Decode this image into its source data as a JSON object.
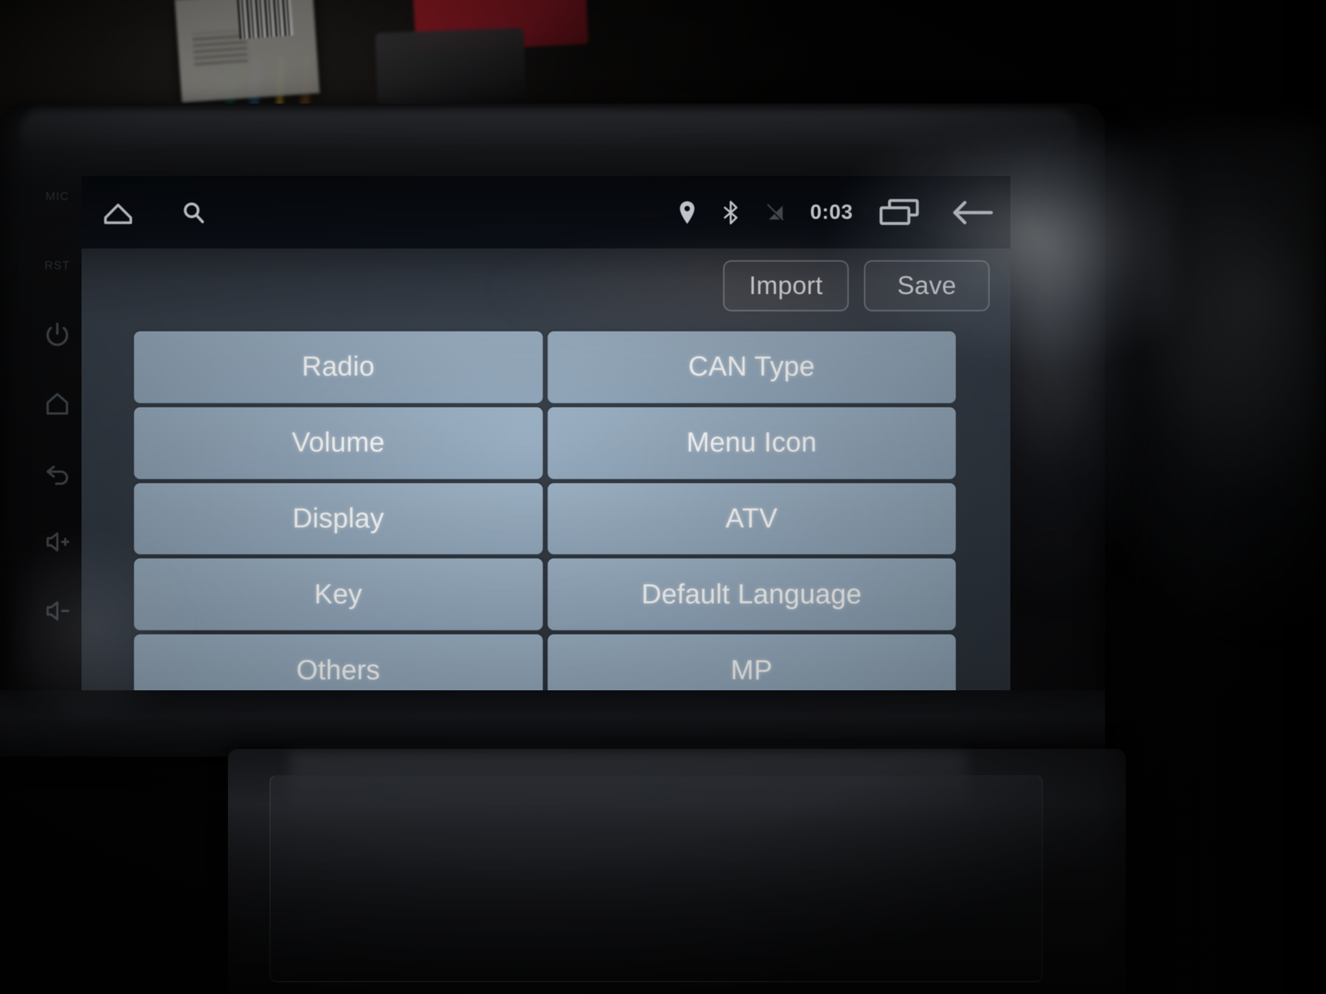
{
  "device": {
    "type": "car-head-unit",
    "hardware_keys": [
      {
        "name": "mic",
        "label": "MIC",
        "icon": "microphone-label"
      },
      {
        "name": "reset",
        "label": "RST",
        "icon": "reset-label"
      },
      {
        "name": "power",
        "label": "",
        "icon": "power-icon"
      },
      {
        "name": "home",
        "label": "",
        "icon": "home-icon"
      },
      {
        "name": "back",
        "label": "",
        "icon": "back-icon"
      },
      {
        "name": "volume-up",
        "label": "",
        "icon": "volume-up-icon"
      },
      {
        "name": "volume-down",
        "label": "",
        "icon": "volume-down-icon"
      }
    ]
  },
  "statusbar": {
    "home_icon": "home-icon",
    "search_icon": "search-icon",
    "location_icon": "location-pin-icon",
    "bluetooth_icon": "bluetooth-icon",
    "signal_off_icon": "signal-off-icon",
    "clock": "0:03",
    "recents_icon": "recent-apps-icon",
    "back_icon": "back-arrow-icon"
  },
  "actionbar": {
    "import_label": "Import",
    "save_label": "Save"
  },
  "menu": {
    "items": [
      {
        "label": "Radio",
        "column": "left",
        "row": 1
      },
      {
        "label": "CAN Type",
        "column": "right",
        "row": 1
      },
      {
        "label": "Volume",
        "column": "left",
        "row": 2
      },
      {
        "label": "Menu Icon",
        "column": "right",
        "row": 2
      },
      {
        "label": "Display",
        "column": "left",
        "row": 3
      },
      {
        "label": "ATV",
        "column": "right",
        "row": 3
      },
      {
        "label": "Key",
        "column": "left",
        "row": 4
      },
      {
        "label": "Default Language",
        "column": "right",
        "row": 4
      },
      {
        "label": "Others",
        "column": "left",
        "row": 5
      },
      {
        "label": "MP",
        "column": "right",
        "row": 5
      }
    ]
  },
  "colors": {
    "button_fill": "#98adc0",
    "button_text": "#ffffff",
    "panel_bg": "#333b45",
    "statusbar_bg": "#0a0e15",
    "accent_border": "#d7e4f5"
  }
}
